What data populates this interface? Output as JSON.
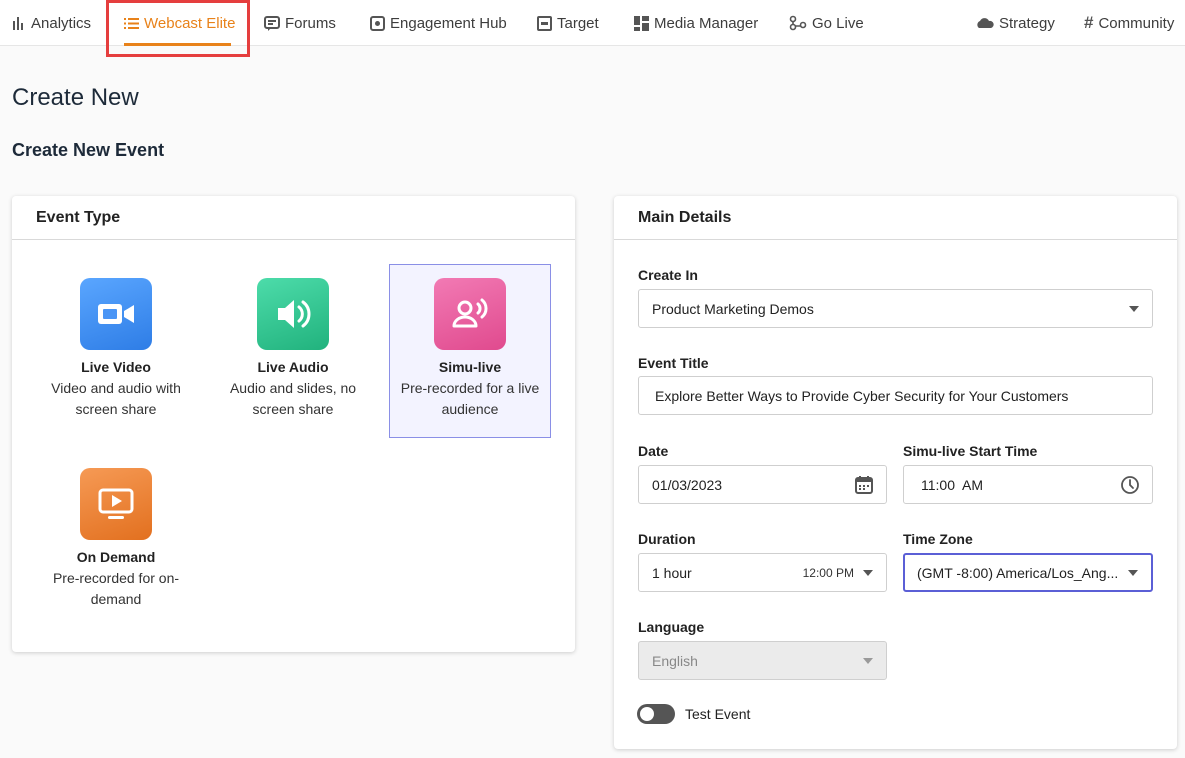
{
  "nav": {
    "items": [
      {
        "label": "Analytics",
        "icon": "bar-chart-icon"
      },
      {
        "label": "Webcast Elite",
        "icon": "list-icon",
        "active": true
      },
      {
        "label": "Forums",
        "icon": "chat-bubble-icon"
      },
      {
        "label": "Engagement Hub",
        "icon": "hub-icon"
      },
      {
        "label": "Target",
        "icon": "target-icon"
      },
      {
        "label": "Media Manager",
        "icon": "grid-icon"
      },
      {
        "label": "Go Live",
        "icon": "nodes-icon"
      },
      {
        "label": "Strategy",
        "icon": "cloud-icon"
      },
      {
        "label": "Community",
        "icon": "hashtag-icon"
      }
    ],
    "accent_color": "#e8821a"
  },
  "page": {
    "title": "Create New",
    "subtitle": "Create New Event"
  },
  "event_type": {
    "header": "Event Type",
    "options": [
      {
        "label": "Live Video",
        "desc": "Video and audio with screen share",
        "icon": "video-camera-icon",
        "color": "#3f8ff0"
      },
      {
        "label": "Live Audio",
        "desc": "Audio and slides, no screen share",
        "icon": "speaker-icon",
        "color": "#2fc48f"
      },
      {
        "label": "Simu-live",
        "desc": "Pre-recorded for a live audience",
        "icon": "presenter-icon",
        "color": "#e8559a",
        "selected": true
      },
      {
        "label": "On Demand",
        "desc": "Pre-recorded for on-demand",
        "icon": "play-screen-icon",
        "color": "#ec8035"
      }
    ]
  },
  "main_details": {
    "header": "Main Details",
    "create_in": {
      "label": "Create In",
      "value": "Product Marketing Demos"
    },
    "event_title": {
      "label": "Event Title",
      "value": "Explore Better Ways to Provide Cyber Security for Your Customers"
    },
    "date": {
      "label": "Date",
      "value": "01/03/2023"
    },
    "start_time": {
      "label": "Simu-live Start Time",
      "value": "11:00  AM"
    },
    "duration": {
      "label": "Duration",
      "value": "1 hour",
      "end_time": "12:00 PM"
    },
    "time_zone": {
      "label": "Time Zone",
      "value": "(GMT -8:00) America/Los_Ang..."
    },
    "language": {
      "label": "Language",
      "value": "English"
    },
    "test_event": {
      "label": "Test Event",
      "on": false
    }
  }
}
